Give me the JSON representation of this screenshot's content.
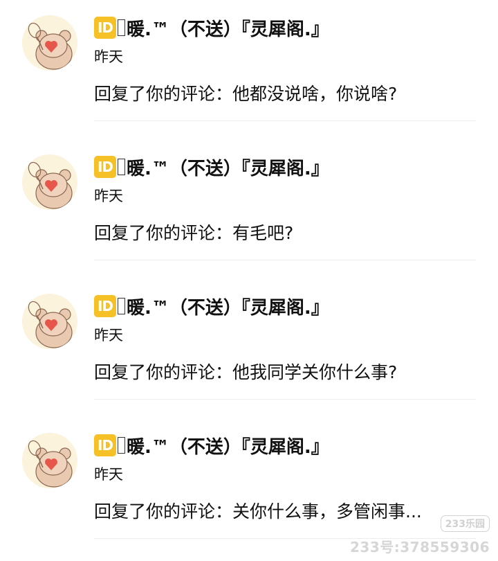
{
  "notifications": [
    {
      "badge": "ID",
      "username": "暖.™（不送）『灵犀阁.』",
      "time": "昨天",
      "content": "回复了你的评论：他都没说啥，你说啥?"
    },
    {
      "badge": "ID",
      "username": "暖.™（不送）『灵犀阁.』",
      "time": "昨天",
      "content": "回复了你的评论：有毛吧?"
    },
    {
      "badge": "ID",
      "username": "暖.™（不送）『灵犀阁.』",
      "time": "昨天",
      "content": "回复了你的评论：他我同学关你什么事?"
    },
    {
      "badge": "ID",
      "username": "暖.™（不送）『灵犀阁.』",
      "time": "昨天",
      "content": "回复了你的评论：关你什么事，多管闲事..."
    }
  ],
  "watermark": {
    "logo": "233乐园",
    "id_text": "233号:378559306"
  },
  "colors": {
    "badge": "#f6c027",
    "avatar_bg": "#fbf3dc",
    "divider": "#ececec",
    "watermark": "#d6d6d6"
  }
}
